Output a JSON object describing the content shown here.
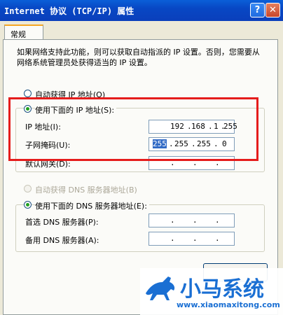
{
  "window": {
    "title": "Internet 协议 (TCP/IP) 属性",
    "help_btn": "?",
    "close_btn": "✕"
  },
  "tab": {
    "label": "常规"
  },
  "description": "如果网络支持此功能，则可以获取自动指派的 IP 设置。否则，您需要从网络系统管理员处获得适当的 IP 设置。",
  "ip_section": {
    "auto_label": "自动获得 IP 地址(O)",
    "manual_label": "使用下面的 IP 地址(S):",
    "ip_label": "IP 地址(I):",
    "ip_value": [
      "192",
      "168",
      "1",
      "255"
    ],
    "mask_label": "子网掩码(U):",
    "mask_value": [
      "255",
      "255",
      "255",
      "0"
    ],
    "gateway_label": "默认网关(D):",
    "gateway_value": [
      "",
      "",
      "",
      ""
    ]
  },
  "dns_section": {
    "auto_label": "自动获得 DNS 服务器地址(B)",
    "manual_label": "使用下面的 DNS 服务器地址(E):",
    "preferred_label": "首选 DNS 服务器(P):",
    "alternate_label": "备用 DNS 服务器(A):"
  },
  "watermark": {
    "title": "小马系统",
    "url": "www.xiaomaxitong.com"
  },
  "colors": {
    "titlebar": "#0a4fd0",
    "highlight_box": "#e51c1c",
    "watermark": "#1a6fd3"
  }
}
